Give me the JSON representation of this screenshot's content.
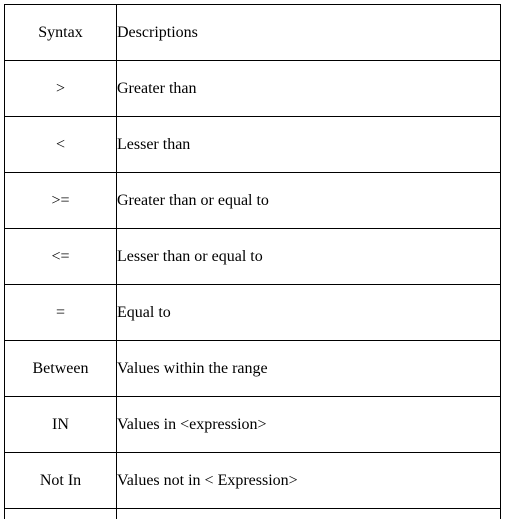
{
  "table": {
    "columns": [
      {
        "key": "syntax",
        "header": "Syntax"
      },
      {
        "key": "description",
        "header": "Descriptions"
      }
    ],
    "header": {
      "syntax": "Syntax",
      "description": "Descriptions"
    },
    "rows": [
      {
        "syntax": ">",
        "description": "Greater than"
      },
      {
        "syntax": "<",
        "description": "Lesser than"
      },
      {
        "syntax": ">=",
        "description": "Greater than or equal to"
      },
      {
        "syntax": "<=",
        "description": "Lesser than or equal to"
      },
      {
        "syntax": "=",
        "description": "Equal to"
      },
      {
        "syntax": "Between",
        "description": "Values within the range"
      },
      {
        "syntax": "IN",
        "description": "Values in <expression>"
      },
      {
        "syntax": "Not In",
        "description": "Values not in < Expression>"
      }
    ],
    "partial_row": {
      "syntax": "",
      "description": ""
    },
    "colors": {
      "border": "#000000",
      "text": "#000000",
      "background": "#ffffff"
    }
  }
}
